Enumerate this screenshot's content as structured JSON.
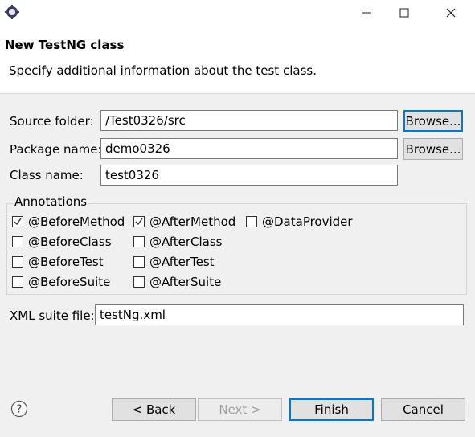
{
  "window": {
    "app_icon": "eclipse-gear-icon",
    "minimize_icon": "minimize-icon",
    "maximize_icon": "maximize-icon",
    "close_icon": "close-icon"
  },
  "header": {
    "title": "New TestNG class",
    "description": "Specify additional information about the test class."
  },
  "form": {
    "source_folder": {
      "label": "Source folder:",
      "value": "/Test0326/src",
      "browse": "Browse..."
    },
    "package_name": {
      "label": "Package name:",
      "value": "demo0326",
      "browse": "Browse..."
    },
    "class_name": {
      "label": "Class name:",
      "value": "test0326"
    },
    "xml_suite": {
      "label": "XML suite file:",
      "value": "testNg.xml"
    }
  },
  "annotations": {
    "title": "Annotations",
    "before_method": {
      "label": "@BeforeMethod",
      "checked": true
    },
    "after_method": {
      "label": "@AfterMethod",
      "checked": true
    },
    "data_provider": {
      "label": "@DataProvider",
      "checked": false
    },
    "before_class": {
      "label": "@BeforeClass",
      "checked": false
    },
    "after_class": {
      "label": "@AfterClass",
      "checked": false
    },
    "before_test": {
      "label": "@BeforeTest",
      "checked": false
    },
    "after_test": {
      "label": "@AfterTest",
      "checked": false
    },
    "before_suite": {
      "label": "@BeforeSuite",
      "checked": false
    },
    "after_suite": {
      "label": "@AfterSuite",
      "checked": false
    }
  },
  "footer": {
    "help_icon": "question-mark-icon",
    "back": "< Back",
    "next": "Next >",
    "finish": "Finish",
    "cancel": "Cancel"
  },
  "colors": {
    "focus_blue": "#0078d7",
    "dialog_bg": "#f0f0f0"
  }
}
